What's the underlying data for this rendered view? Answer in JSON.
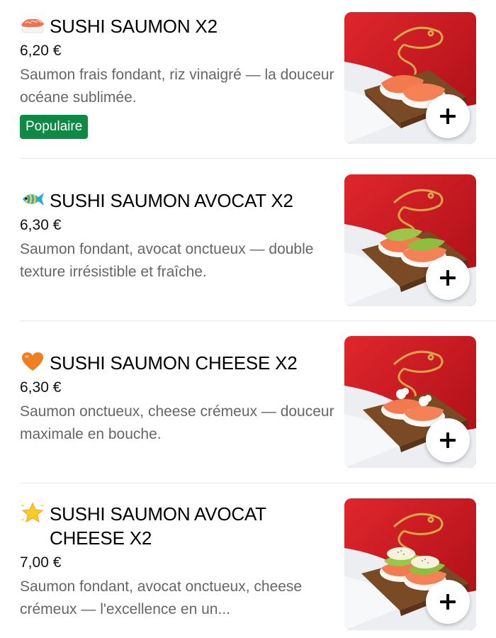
{
  "menu": {
    "items": [
      {
        "emoji_icon": "sushi-icon",
        "title": "SUSHI SAUMON X2",
        "price": "6,20 €",
        "description": "Saumon frais fondant, riz vinaigré — la douceur océane sublimée.",
        "badge": "Populaire",
        "image_icon": "salmon-nigiri-image",
        "add_icon": "plus-icon"
      },
      {
        "emoji_icon": "tropical-fish-icon",
        "title": "SUSHI SAUMON AVOCAT X2",
        "price": "6,30 €",
        "description": "Saumon fondant, avocat onctueux — double texture irrésistible et fraîche.",
        "image_icon": "salmon-avocado-nigiri-image",
        "add_icon": "plus-icon"
      },
      {
        "emoji_icon": "orange-heart-icon",
        "title": "SUSHI SAUMON CHEESE X2",
        "price": "6,30 €",
        "description": "Saumon onctueux, cheese crémeux — douceur maximale en bouche.",
        "image_icon": "salmon-cheese-nigiri-image",
        "add_icon": "plus-icon"
      },
      {
        "emoji_icon": "glowing-star-icon",
        "title": "SUSHI SAUMON AVOCAT CHEESE X2",
        "price": "7,00 €",
        "description": "Saumon fondant, avocat onctueux, cheese crémeux — l'excellence en un...",
        "image_icon": "salmon-avocado-cheese-nigiri-image",
        "add_icon": "plus-icon"
      }
    ]
  },
  "colors": {
    "badge_green": "#0e8a45",
    "description_gray": "#666666",
    "image_red": "#c8141b",
    "logo_gold": "#d9a648"
  }
}
